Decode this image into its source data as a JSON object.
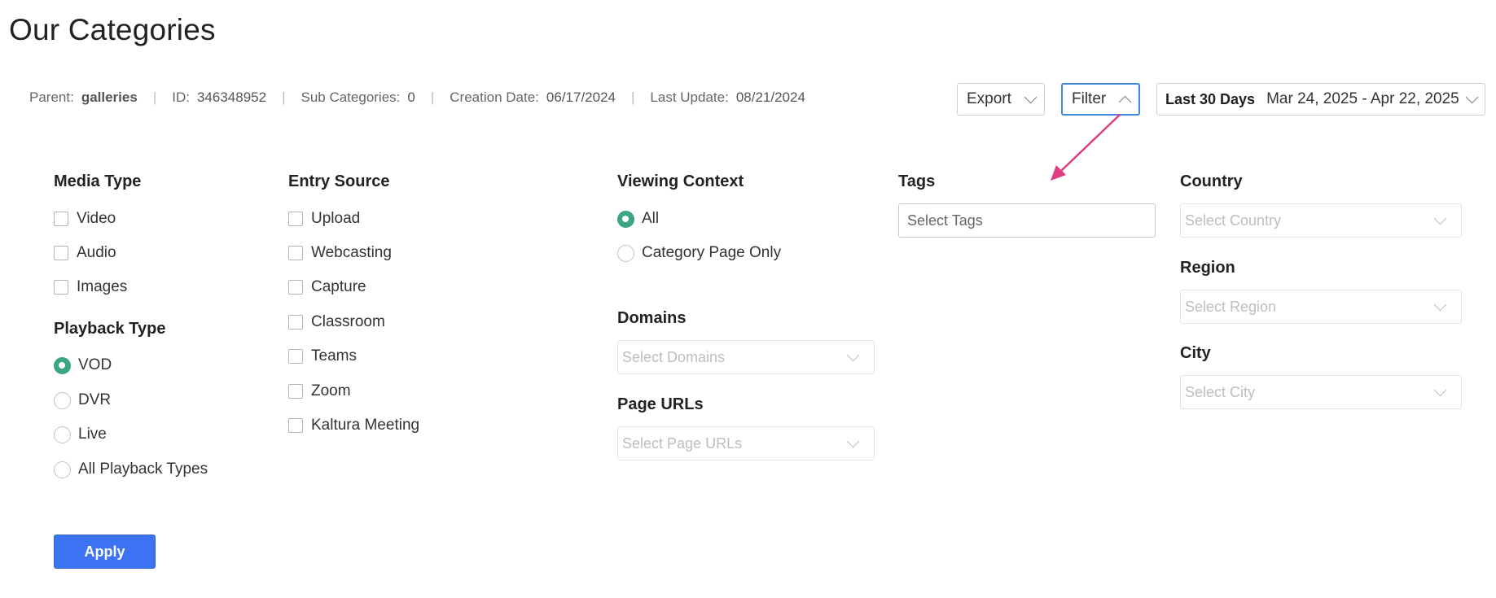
{
  "page": {
    "title": "Our Categories"
  },
  "meta": {
    "parent_label": "Parent:",
    "parent_value": "galleries",
    "id_label": "ID:",
    "id_value": "346348952",
    "sub_label": "Sub Categories:",
    "sub_value": "0",
    "created_label": "Creation Date:",
    "created_value": "06/17/2024",
    "updated_label": "Last Update:",
    "updated_value": "08/21/2024",
    "separator": "|"
  },
  "toolbar": {
    "export_label": "Export",
    "filter_label": "Filter",
    "date_preset": "Last 30 Days",
    "date_range": "Mar 24, 2025 - Apr 22, 2025"
  },
  "filters": {
    "media_type": {
      "title": "Media Type",
      "options": [
        "Video",
        "Audio",
        "Images"
      ]
    },
    "playback_type": {
      "title": "Playback Type",
      "options": [
        "VOD",
        "DVR",
        "Live",
        "All Playback Types"
      ],
      "selected": "VOD"
    },
    "entry_source": {
      "title": "Entry Source",
      "options": [
        "Upload",
        "Webcasting",
        "Capture",
        "Classroom",
        "Teams",
        "Zoom",
        "Kaltura Meeting"
      ]
    },
    "viewing_context": {
      "title": "Viewing Context",
      "options": [
        "All",
        "Category Page Only"
      ],
      "selected": "All"
    },
    "domains": {
      "title": "Domains",
      "placeholder": "Select Domains"
    },
    "page_urls": {
      "title": "Page URLs",
      "placeholder": "Select Page URLs"
    },
    "tags": {
      "title": "Tags",
      "placeholder": "Select Tags"
    },
    "country": {
      "title": "Country",
      "placeholder": "Select Country"
    },
    "region": {
      "title": "Region",
      "placeholder": "Select Region"
    },
    "city": {
      "title": "City",
      "placeholder": "Select City"
    }
  },
  "apply_label": "Apply",
  "colors": {
    "accent_radio": "#3aa582",
    "apply_button": "#3b73f2",
    "annotation_arrow": "#e03c83",
    "filter_border": "#3f86d8"
  }
}
